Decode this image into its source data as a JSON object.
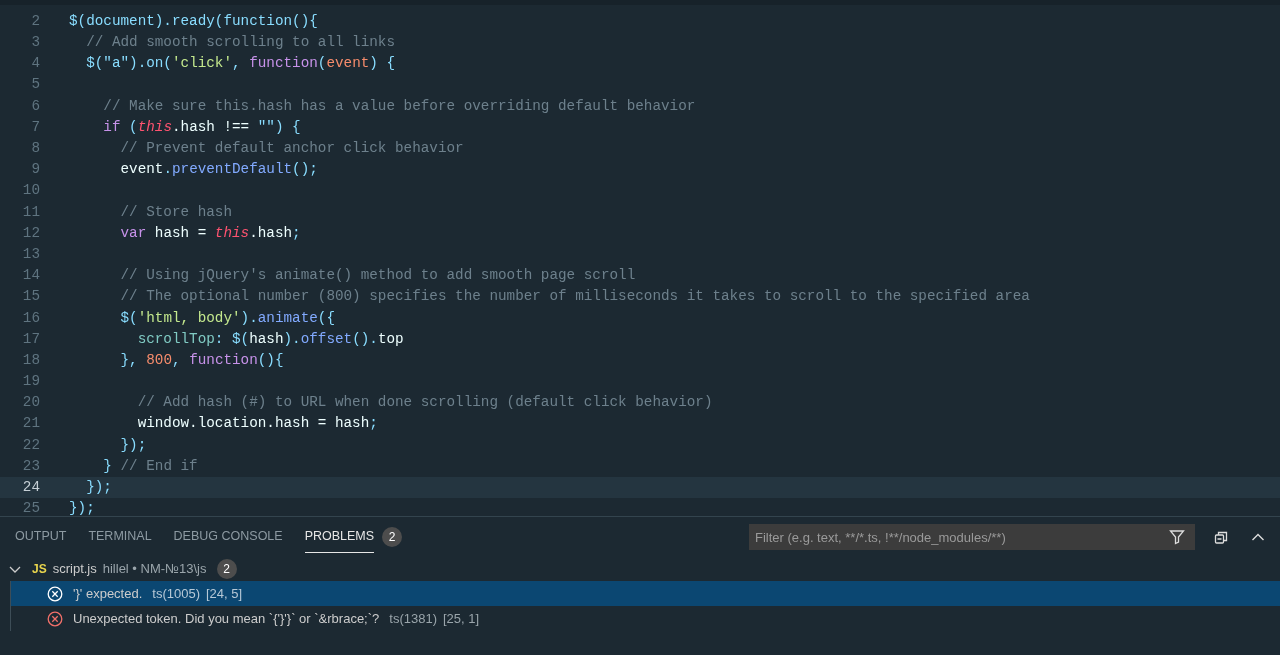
{
  "editor": {
    "lines": [
      {
        "number": "2",
        "current": false,
        "tokens": [
          {
            "kind": "punct",
            "text": "$(document).ready(function(){"
          }
        ]
      },
      {
        "number": "3",
        "current": false,
        "tokens": [
          {
            "kind": "comment",
            "text": "  // Add smooth scrolling to all links"
          }
        ]
      },
      {
        "number": "4",
        "current": false,
        "tokens": [
          {
            "kind": "punct",
            "text": "  $(\"a\").on("
          },
          {
            "kind": "string",
            "text": "'click'"
          },
          {
            "kind": "punct",
            "text": ", "
          },
          {
            "kind": "keyword",
            "text": "function"
          },
          {
            "kind": "punct",
            "text": "("
          },
          {
            "kind": "param",
            "text": "event"
          },
          {
            "kind": "punct",
            "text": ") {"
          }
        ]
      },
      {
        "number": "5",
        "current": false
      },
      {
        "number": "6",
        "current": false,
        "tokens": [
          {
            "kind": "comment",
            "text": "    // Make sure this.hash has a value before overriding default behavior"
          }
        ]
      },
      {
        "number": "7",
        "current": false,
        "tokens": [
          {
            "kind": "keyword",
            "text": "    if "
          },
          {
            "kind": "punct",
            "text": "("
          },
          {
            "kind": "this",
            "text": "this"
          },
          {
            "kind": "ident",
            "text": ".hash !== "
          },
          {
            "kind": "punct",
            "text": "\"\") {"
          }
        ]
      },
      {
        "number": "8",
        "current": false,
        "tokens": [
          {
            "kind": "comment",
            "text": "      // Prevent default anchor click behavior"
          }
        ]
      },
      {
        "number": "9",
        "current": false,
        "tokens": [
          {
            "kind": "ident",
            "text": "      event"
          },
          {
            "kind": "punct",
            "text": "."
          },
          {
            "kind": "method",
            "text": "preventDefault"
          },
          {
            "kind": "punct",
            "text": "();"
          }
        ]
      },
      {
        "number": "10",
        "current": false
      },
      {
        "number": "11",
        "current": false,
        "tokens": [
          {
            "kind": "comment",
            "text": "      // Store hash"
          }
        ]
      },
      {
        "number": "12",
        "current": false,
        "tokens": [
          {
            "kind": "keyword",
            "text": "      var "
          },
          {
            "kind": "ident",
            "text": "hash = "
          },
          {
            "kind": "this",
            "text": "this"
          },
          {
            "kind": "ident",
            "text": ".hash"
          },
          {
            "kind": "punct",
            "text": ";"
          }
        ]
      },
      {
        "number": "13",
        "current": false
      },
      {
        "number": "14",
        "current": false,
        "tokens": [
          {
            "kind": "comment",
            "text": "      // Using jQuery's animate() method to add smooth page scroll"
          }
        ]
      },
      {
        "number": "15",
        "current": false,
        "tokens": [
          {
            "kind": "comment",
            "text": "      // The optional number (800) specifies the number of milliseconds it takes to scroll to the specified area"
          }
        ]
      },
      {
        "number": "16",
        "current": false,
        "tokens": [
          {
            "kind": "punct",
            "text": "      $("
          },
          {
            "kind": "string",
            "text": "'html, body'"
          },
          {
            "kind": "punct",
            "text": ")."
          },
          {
            "kind": "method",
            "text": "animate"
          },
          {
            "kind": "punct",
            "text": "({"
          }
        ]
      },
      {
        "number": "17",
        "current": false,
        "tokens": [
          {
            "kind": "prop",
            "text": "        scrollTop"
          },
          {
            "kind": "punct",
            "text": ": $("
          },
          {
            "kind": "ident",
            "text": "hash"
          },
          {
            "kind": "punct",
            "text": ")."
          },
          {
            "kind": "method",
            "text": "offset"
          },
          {
            "kind": "punct",
            "text": "()."
          },
          {
            "kind": "ident",
            "text": "top"
          }
        ]
      },
      {
        "number": "18",
        "current": false,
        "tokens": [
          {
            "kind": "punct",
            "text": "      }, "
          },
          {
            "kind": "number",
            "text": "800"
          },
          {
            "kind": "punct",
            "text": ", "
          },
          {
            "kind": "keyword",
            "text": "function"
          },
          {
            "kind": "punct",
            "text": "(){"
          }
        ]
      },
      {
        "number": "19",
        "current": false
      },
      {
        "number": "20",
        "current": false,
        "tokens": [
          {
            "kind": "comment",
            "text": "        // Add hash (#) to URL when done scrolling (default click behavior)"
          }
        ]
      },
      {
        "number": "21",
        "current": false,
        "tokens": [
          {
            "kind": "ident",
            "text": "        window.location.hash = hash"
          },
          {
            "kind": "punct",
            "text": ";"
          }
        ]
      },
      {
        "number": "22",
        "current": false,
        "tokens": [
          {
            "kind": "punct",
            "text": "      });"
          }
        ]
      },
      {
        "number": "23",
        "current": false,
        "tokens": [
          {
            "kind": "punct",
            "text": "    } "
          },
          {
            "kind": "comment",
            "text": "// End if"
          }
        ]
      },
      {
        "number": "24",
        "current": true,
        "tokens": [
          {
            "kind": "punct",
            "text": "  });"
          }
        ]
      },
      {
        "number": "25",
        "current": false,
        "tokens": [
          {
            "kind": "punct",
            "text": "});"
          }
        ]
      }
    ]
  },
  "panel": {
    "tabs": [
      {
        "label": "OUTPUT",
        "selected": false
      },
      {
        "label": "TERMINAL",
        "selected": false
      },
      {
        "label": "DEBUG CONSOLE",
        "selected": false
      },
      {
        "label": "PROBLEMS",
        "selected": true,
        "count": "2"
      }
    ],
    "filter": {
      "placeholder": "Filter (e.g. text, **/*.ts, !**/node_modules/**)"
    },
    "file": {
      "expanded": true,
      "badge": "JS",
      "name": "script.js",
      "path": "hillel • NM-№13\\js",
      "count": "2"
    },
    "problems": [
      {
        "selected": true,
        "message": "'}' expected.",
        "code": "ts(1005)",
        "position": "[24, 5]"
      },
      {
        "selected": false,
        "message": "Unexpected token. Did you mean `{'}'}` or `&rbrace;`?",
        "code": "ts(1381)",
        "position": "[25, 1]"
      }
    ]
  }
}
